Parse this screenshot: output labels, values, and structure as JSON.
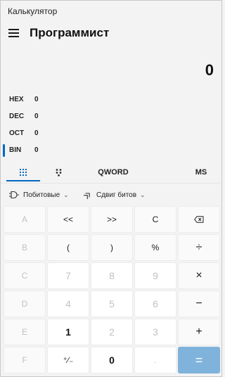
{
  "app": {
    "title": "Калькулятор",
    "mode": "Программист",
    "display": "0"
  },
  "radix": [
    {
      "label": "HEX",
      "value": "0"
    },
    {
      "label": "DEC",
      "value": "0"
    },
    {
      "label": "OCT",
      "value": "0"
    },
    {
      "label": "BIN",
      "value": "0",
      "selected": true
    }
  ],
  "tabs": {
    "keypad_icon": "keypad-grid-icon",
    "bitpad_icon": "bit-toggle-icon",
    "word_size": "QWORD",
    "memory_store": "MS"
  },
  "ops": {
    "bitwise": "Побитовые",
    "bitshift": "Сдвиг битов",
    "bitwise_icon": "logic-gate-icon",
    "bitshift_icon": "double-chevron-icon"
  },
  "keys": {
    "A": "A",
    "lshift": "<<",
    "rshift": ">>",
    "clear": "C",
    "backspace": "⌫",
    "B": "B",
    "lparen": "(",
    "rparen": ")",
    "mod": "%",
    "divide": "÷",
    "C": "C",
    "d7": "7",
    "d8": "8",
    "d9": "9",
    "multiply": "×",
    "D": "D",
    "d4": "4",
    "d5": "5",
    "d6": "6",
    "minus": "−",
    "E": "E",
    "d1": "1",
    "d2": "2",
    "d3": "3",
    "plus": "+",
    "F": "F",
    "negate": "⁺∕₋",
    "d0": "0",
    "decimal": ".",
    "equals": "="
  },
  "colors": {
    "accent": "#0067c0",
    "equals_key": "#7fb3db",
    "background": "#f3f3f3"
  }
}
